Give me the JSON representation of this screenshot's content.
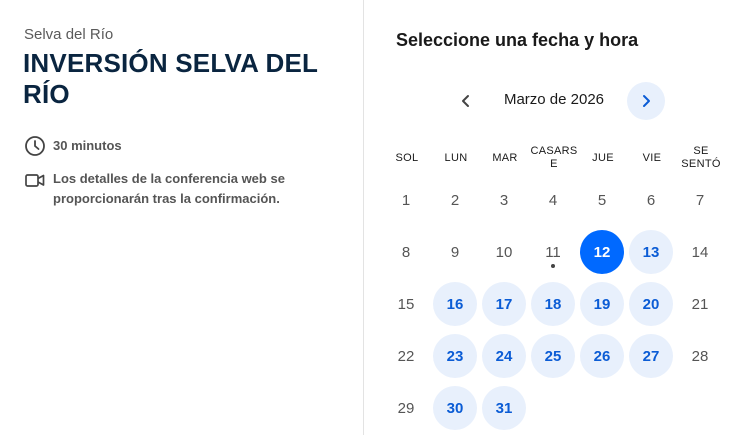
{
  "event": {
    "organizer": "Selva del Río",
    "title": "INVERSIÓN SELVA DEL RÍO",
    "duration": "30 minutos",
    "conference_note": "Los detalles de la conferencia web se proporcionarán tras la confirmación."
  },
  "icons": {
    "duration": "clock-icon",
    "conference": "video-camera-icon",
    "prev": "chevron-left-icon",
    "next": "chevron-right-icon"
  },
  "calendar": {
    "heading": "Seleccione una fecha y hora",
    "month_label": "Marzo de 2026",
    "weekdays": [
      "SOL",
      "LUN",
      "MAR",
      "CASARSE",
      "JUE",
      "VIE",
      "SE SENTÓ"
    ],
    "weekday_lines": [
      [
        "SOL"
      ],
      [
        "LUN"
      ],
      [
        "MAR"
      ],
      [
        "CASARS",
        "E"
      ],
      [
        "JUE"
      ],
      [
        "VIE"
      ],
      [
        "SE",
        "SENTÓ"
      ]
    ],
    "weeks": [
      [
        {
          "d": "1",
          "s": "u"
        },
        {
          "d": "2",
          "s": "u"
        },
        {
          "d": "3",
          "s": "u"
        },
        {
          "d": "4",
          "s": "u"
        },
        {
          "d": "5",
          "s": "u"
        },
        {
          "d": "6",
          "s": "u"
        },
        {
          "d": "7",
          "s": "u"
        }
      ],
      [
        {
          "d": "8",
          "s": "u"
        },
        {
          "d": "9",
          "s": "u"
        },
        {
          "d": "10",
          "s": "u"
        },
        {
          "d": "11",
          "s": "today"
        },
        {
          "d": "12",
          "s": "selected"
        },
        {
          "d": "13",
          "s": "a"
        },
        {
          "d": "14",
          "s": "u"
        }
      ],
      [
        {
          "d": "15",
          "s": "u"
        },
        {
          "d": "16",
          "s": "a"
        },
        {
          "d": "17",
          "s": "a"
        },
        {
          "d": "18",
          "s": "a"
        },
        {
          "d": "19",
          "s": "a"
        },
        {
          "d": "20",
          "s": "a"
        },
        {
          "d": "21",
          "s": "u"
        }
      ],
      [
        {
          "d": "22",
          "s": "u"
        },
        {
          "d": "23",
          "s": "a"
        },
        {
          "d": "24",
          "s": "a"
        },
        {
          "d": "25",
          "s": "a"
        },
        {
          "d": "26",
          "s": "a"
        },
        {
          "d": "27",
          "s": "a"
        },
        {
          "d": "28",
          "s": "u"
        }
      ],
      [
        {
          "d": "29",
          "s": "u"
        },
        {
          "d": "30",
          "s": "a"
        },
        {
          "d": "31",
          "s": "a"
        }
      ]
    ],
    "selected_date": "12",
    "colors": {
      "selected_bg": "#0069ff",
      "available_bg": "#e8f0fc",
      "available_text": "#0b5cd5",
      "title_color": "#0a2540"
    }
  }
}
